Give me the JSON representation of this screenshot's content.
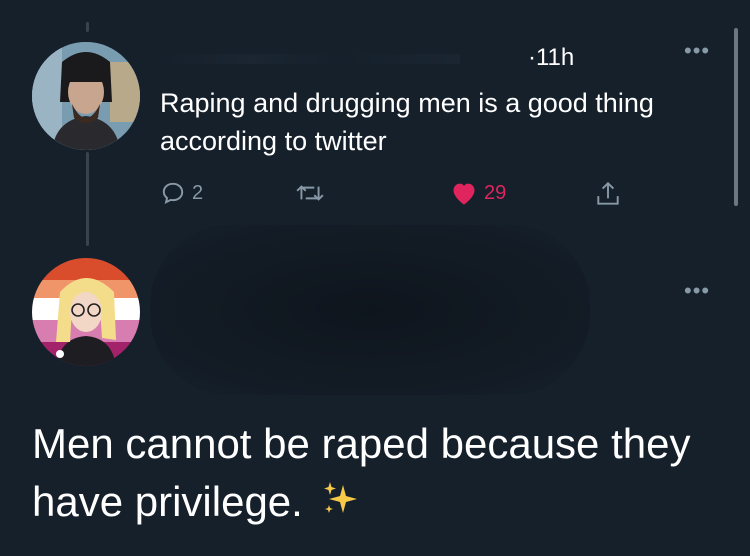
{
  "tweet": {
    "time": "·11h",
    "text": "Raping and drugging men is a good thing according to twitter",
    "reply_count": "2",
    "like_count": "29"
  },
  "reply": {
    "text": "Men cannot be raped because they have privilege."
  },
  "icons": {
    "reply": "speech-bubble-icon",
    "retweet": "retweet-icon",
    "like": "heart-icon",
    "share": "share-icon",
    "more": "more-dots-icon",
    "sparkles": "sparkles-icon"
  },
  "colors": {
    "background": "#15202b",
    "muted": "#8899a6",
    "like": "#e0245e"
  }
}
